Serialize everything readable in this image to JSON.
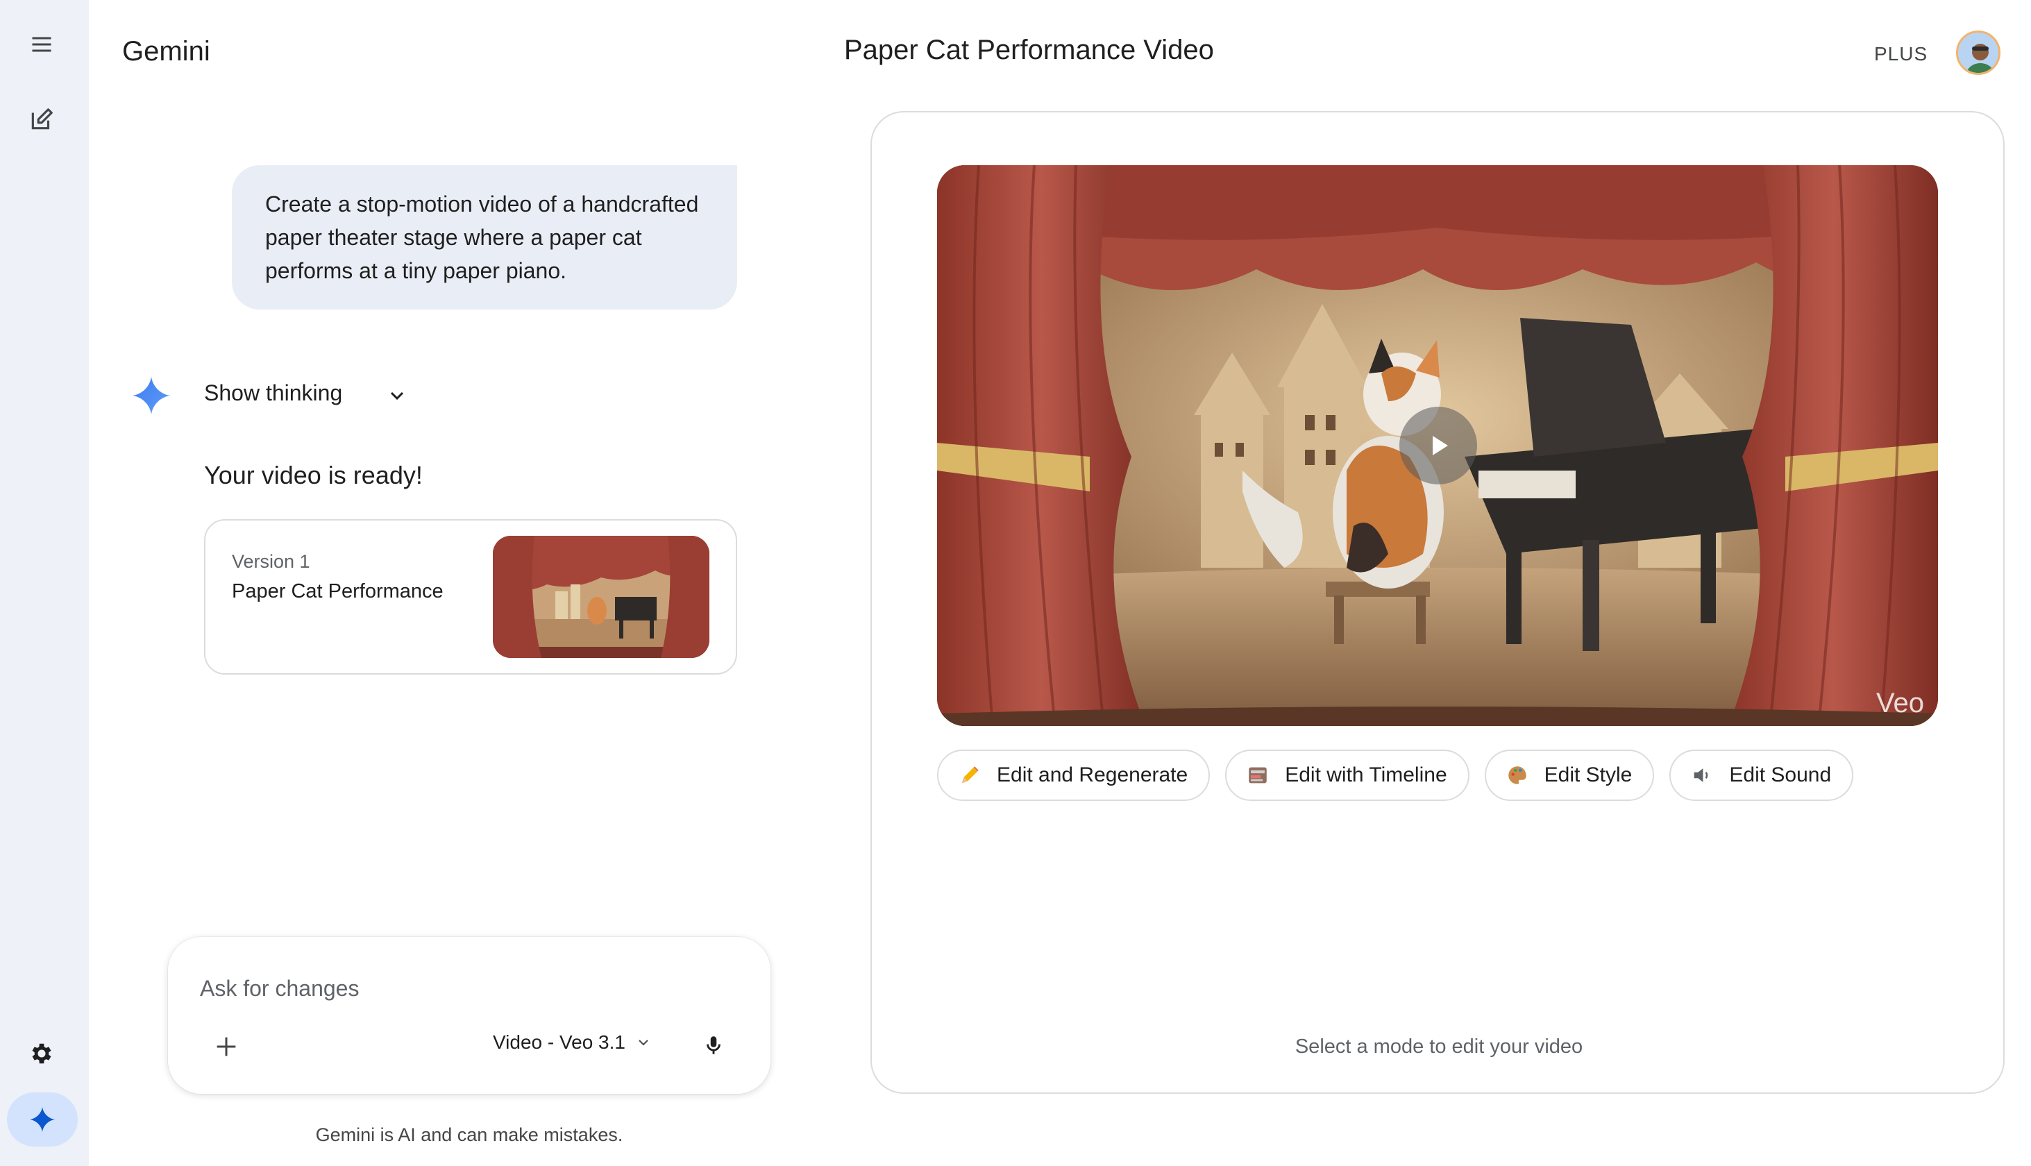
{
  "app": {
    "name": "Gemini",
    "plan_badge": "PLUS"
  },
  "rail": {
    "menu_icon": "hamburger-menu-icon",
    "new_chat_icon": "new-chat-icon",
    "settings_icon": "gear-icon",
    "gem_icon": "gemini-sparkle-icon"
  },
  "conversation": {
    "user_prompt": "Create a stop-motion video of a handcrafted paper theater stage where a paper cat performs at a tiny paper piano.",
    "show_thinking_label": "Show thinking",
    "response_text": "Your video is ready!",
    "version_card": {
      "version_label": "Version 1",
      "title": "Paper Cat Performance"
    }
  },
  "input": {
    "placeholder": "Ask for changes",
    "model_label": "Video - Veo 3.1",
    "disclaimer": "Gemini is AI and can make mistakes."
  },
  "panel": {
    "title": "Paper Cat Performance Video",
    "watermark": "Veo",
    "edit_buttons": [
      {
        "label": "Edit and Regenerate",
        "icon": "pencil-icon"
      },
      {
        "label": "Edit with Timeline",
        "icon": "timeline-icon"
      },
      {
        "label": "Edit Style",
        "icon": "palette-icon"
      },
      {
        "label": "Edit Sound",
        "icon": "speaker-icon"
      }
    ],
    "hint": "Select a mode to edit your video"
  },
  "colors": {
    "rail_bg": "#eef1f8",
    "bubble_bg": "#e9eef6",
    "accent_blue": "#4c8df6",
    "curtain_red": "#a5453a"
  }
}
